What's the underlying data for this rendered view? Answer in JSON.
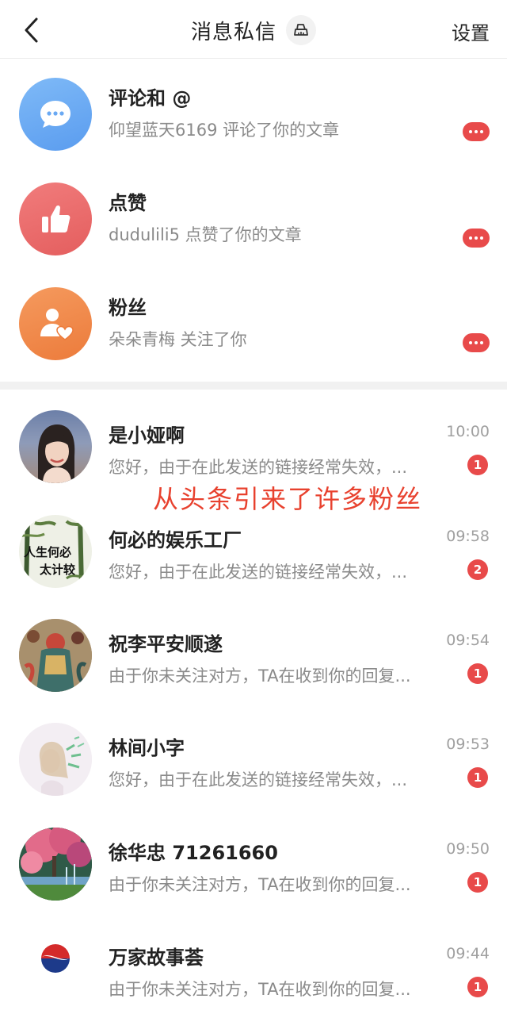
{
  "header": {
    "title": "消息私信",
    "settings_label": "设置"
  },
  "notifications": [
    {
      "name": "评论和 @",
      "subtitle": "仰望蓝天6169 评论了你的文章",
      "icon": "chat-bubble-icon",
      "color": "#6aa9f3"
    },
    {
      "name": "点赞",
      "subtitle": "dudulili5 点赞了你的文章",
      "icon": "thumbs-up-icon",
      "color": "#ec6a6a"
    },
    {
      "name": "粉丝",
      "subtitle": "朵朵青梅 关注了你",
      "icon": "follower-heart-icon",
      "color": "#f0884b"
    }
  ],
  "overlay_text": "从头条引来了许多粉丝",
  "chats": [
    {
      "name": "是小娅啊",
      "time": "10:00",
      "preview": "您好，由于在此发送的链接经常失效，...",
      "badge": "1"
    },
    {
      "name": "何必的娱乐工厂",
      "time": "09:58",
      "preview": "您好，由于在此发送的链接经常失效，...",
      "badge": "2",
      "avatar_text": [
        "人生何必",
        "太计较"
      ]
    },
    {
      "name": "祝李平安顺遂",
      "time": "09:54",
      "preview": "由于你未关注对方，TA在收到你的回复...",
      "badge": "1"
    },
    {
      "name": "林间小字",
      "time": "09:53",
      "preview": "您好，由于在此发送的链接经常失效，...",
      "badge": "1"
    },
    {
      "name": "徐华忠 71261660",
      "time": "09:50",
      "preview": "由于你未关注对方，TA在收到你的回复...",
      "badge": "1"
    },
    {
      "name": "万家故事荟",
      "time": "09:44",
      "preview": "由于你未关注对方，TA在收到你的回复...",
      "badge": "1"
    }
  ],
  "colors": {
    "accent_red": "#e84a4a",
    "overlay_red": "#e8412e"
  }
}
